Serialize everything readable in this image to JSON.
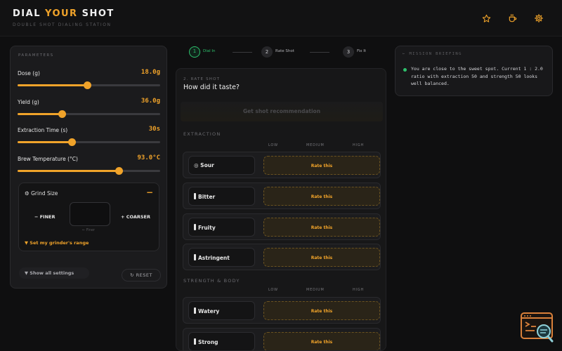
{
  "header": {
    "logo_part1": "DIAL ",
    "logo_part2": "YOUR",
    "logo_part3": " SHOT",
    "tagline": "DOUBLE SHOT DIALING STATION",
    "icons": [
      "star-icon",
      "coffee-cup-icon",
      "gear-icon"
    ]
  },
  "parameters": {
    "title": "PARAMETERS",
    "items": [
      {
        "label": "Dose (g)",
        "value": "18.0g",
        "level": 0.49
      },
      {
        "label": "Yield (g)",
        "value": "36.0g",
        "level": 0.31
      },
      {
        "label": "Extraction Time (s)",
        "value": "30s",
        "level": 0.38
      },
      {
        "label": "Brew Temperature (°C)",
        "value": "93.0°C",
        "level": 0.71
      }
    ],
    "grind": {
      "title": "Grind Size",
      "toggle": "−",
      "finer": "FINER",
      "coarser": "COARSER",
      "hint": "← Finer",
      "range_link": "Set my grinder's range"
    },
    "show_all": "Show all settings",
    "reset": "RESET"
  },
  "stepper": {
    "steps": [
      {
        "num": "1",
        "label": "Dial In"
      },
      {
        "num": "2",
        "label": "Rate Shot"
      },
      {
        "num": "3",
        "label": "Fix It"
      }
    ]
  },
  "rate": {
    "subtitle": "2. RATE SHOT",
    "title": "How did it taste?",
    "get_rec": "Get shot recommendation",
    "columns": [
      "LOW",
      "MEDIUM",
      "HIGH"
    ],
    "rate_label": "Rate this",
    "extraction_title": "EXTRACTION",
    "extraction_rows": [
      "Sour",
      "Bitter",
      "Fruity",
      "Astringent"
    ],
    "body_title": "STRENGTH & BODY",
    "body_rows": [
      "Watery",
      "Strong"
    ]
  },
  "briefing": {
    "title": "MISSION BRIEFING",
    "text": "You are close to the sweet spot. Current 1 : 2.0 ratio with extraction 50 and strength 50 looks well balanced."
  },
  "colors": {
    "accent": "#f0a32a",
    "success": "#2ec06c",
    "background": "#0f0f10"
  }
}
